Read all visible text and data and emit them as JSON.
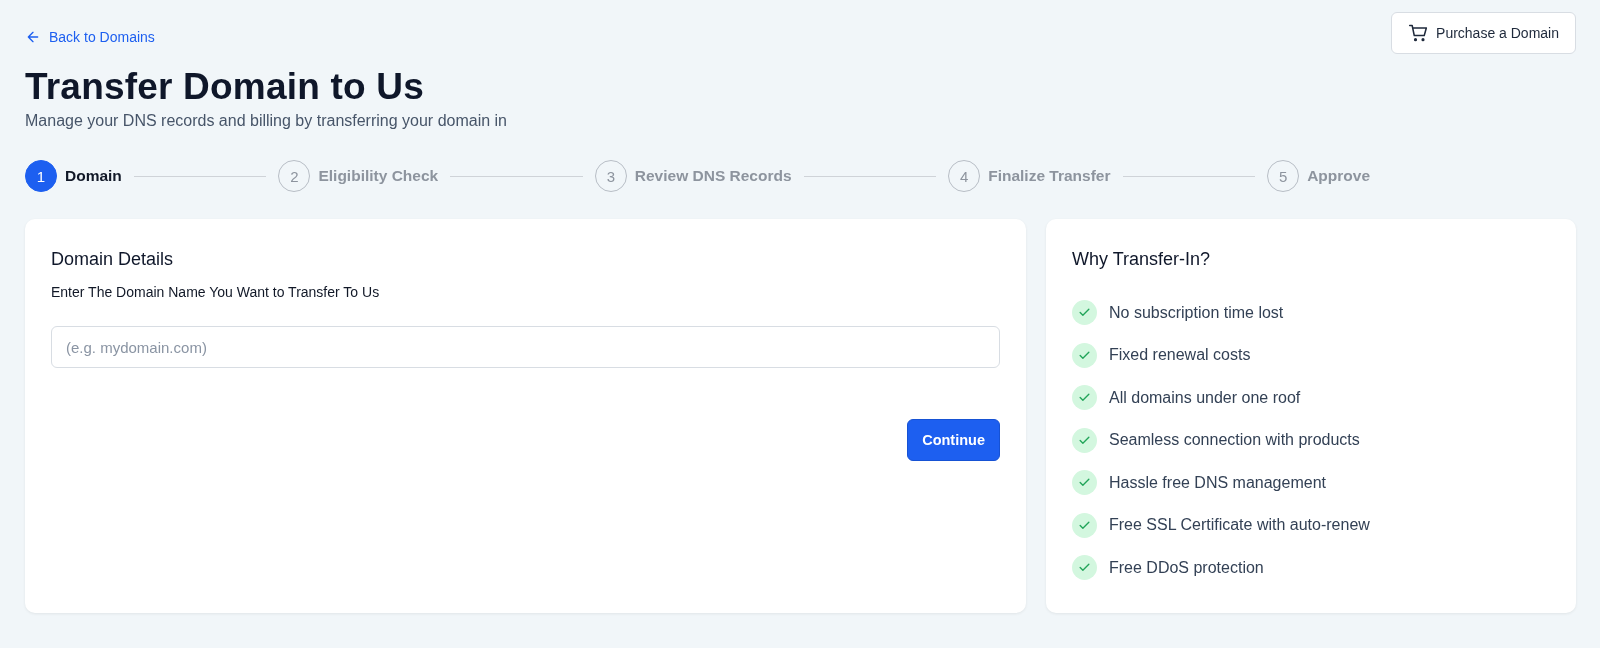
{
  "back_link": "Back to Domains",
  "purchase_button": "Purchase a Domain",
  "title": "Transfer Domain to Us",
  "subtitle": "Manage your DNS records and billing by transferring your domain in",
  "steps": [
    {
      "number": "1",
      "label": "Domain",
      "selected": true
    },
    {
      "number": "2",
      "label": "Eligibility Check",
      "selected": false
    },
    {
      "number": "3",
      "label": "Review DNS Records",
      "selected": false
    },
    {
      "number": "4",
      "label": "Finalize Transfer",
      "selected": false
    },
    {
      "number": "5",
      "label": "Approve",
      "selected": false
    }
  ],
  "domain_card": {
    "heading": "Domain Details",
    "label": "Enter The Domain Name You Want to Transfer To Us",
    "placeholder": "(e.g. mydomain.com)",
    "button": "Continue"
  },
  "benefits": {
    "heading": "Why Transfer-In?",
    "items": [
      "No subscription time lost",
      "Fixed renewal costs",
      "All domains under one roof",
      "Seamless connection with products",
      "Hassle free DNS management",
      "Free SSL Certificate with auto-renew",
      "Free DDoS protection"
    ]
  }
}
